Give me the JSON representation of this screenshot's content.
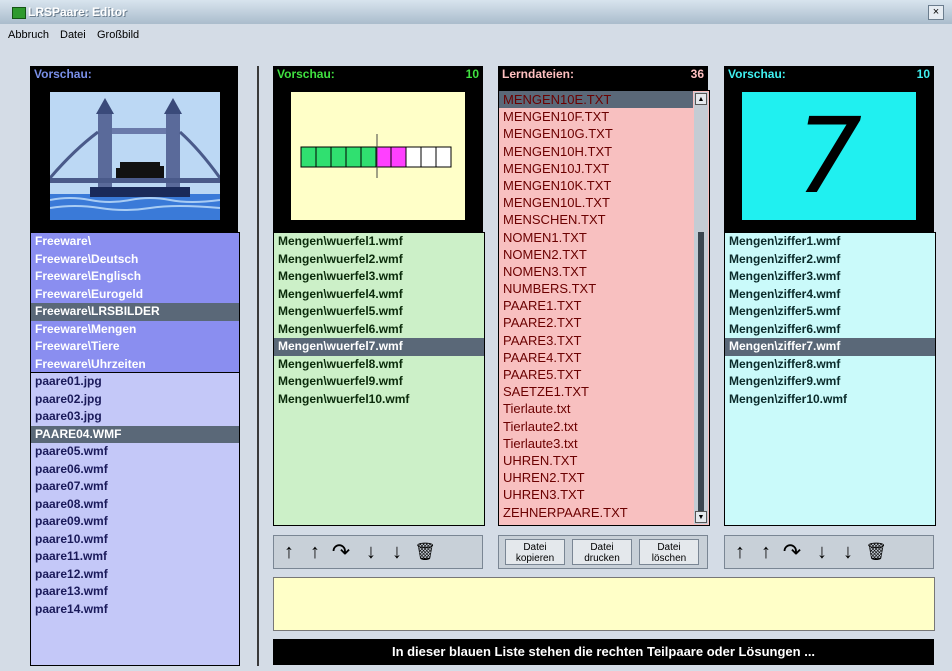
{
  "window": {
    "title": "LRSPaare: Editor",
    "close_glyph": "×"
  },
  "menu": [
    "Abbruch",
    "Datei",
    "Großbild"
  ],
  "left_panel": {
    "header": "Vorschau:",
    "preview_icon": "tower-bridge-image",
    "folders": [
      "Freeware\\",
      "Freeware\\Deutsch",
      "Freeware\\Englisch",
      "Freeware\\Eurogeld",
      "Freeware\\LRSBILDER",
      "Freeware\\Mengen",
      "Freeware\\Tiere",
      "Freeware\\Uhrzeiten"
    ],
    "selected_folder": 4,
    "files": [
      "paare01.jpg",
      "paare02.jpg",
      "paare03.jpg",
      "PAARE04.WMF",
      "paare05.wmf",
      "paare06.wmf",
      "paare07.wmf",
      "paare08.wmf",
      "paare09.wmf",
      "paare10.wmf",
      "paare11.wmf",
      "paare12.wmf",
      "paare13.wmf",
      "paare14.wmf"
    ],
    "selected_file": 3
  },
  "mid_left": {
    "header": "Vorschau:",
    "count": "10",
    "preview_icon": "dice-bar-image",
    "items": [
      "Mengen\\wuerfel1.wmf",
      "Mengen\\wuerfel2.wmf",
      "Mengen\\wuerfel3.wmf",
      "Mengen\\wuerfel4.wmf",
      "Mengen\\wuerfel5.wmf",
      "Mengen\\wuerfel6.wmf",
      "Mengen\\wuerfel7.wmf",
      "Mengen\\wuerfel8.wmf",
      "Mengen\\wuerfel9.wmf",
      "Mengen\\wuerfel10.wmf"
    ],
    "selected": 6
  },
  "lern": {
    "header": "Lerndateien:",
    "count": "36",
    "items": [
      "MENGEN10E.TXT",
      "MENGEN10F.TXT",
      "MENGEN10G.TXT",
      "MENGEN10H.TXT",
      "MENGEN10J.TXT",
      "MENGEN10K.TXT",
      "MENGEN10L.TXT",
      "MENSCHEN.TXT",
      "NOMEN1.TXT",
      "NOMEN2.TXT",
      "NOMEN3.TXT",
      "NUMBERS.TXT",
      "PAARE1.TXT",
      "PAARE2.TXT",
      "PAARE3.TXT",
      "PAARE4.TXT",
      "PAARE5.TXT",
      "SAETZE1.TXT",
      "Tierlaute.txt",
      "Tierlaute2.txt",
      "Tierlaute3.txt",
      "UHREN.TXT",
      "UHREN2.TXT",
      "UHREN3.TXT",
      "ZEHNERPAARE.TXT"
    ],
    "selected": 0,
    "buttons": [
      {
        "line1": "Datei",
        "line2": "kopieren"
      },
      {
        "line1": "Datei",
        "line2": "drucken"
      },
      {
        "line1": "Datei",
        "line2": "löschen"
      }
    ]
  },
  "right_panel": {
    "header": "Vorschau:",
    "count": "10",
    "preview_digit": "7",
    "items": [
      "Mengen\\ziffer1.wmf",
      "Mengen\\ziffer2.wmf",
      "Mengen\\ziffer3.wmf",
      "Mengen\\ziffer4.wmf",
      "Mengen\\ziffer5.wmf",
      "Mengen\\ziffer6.wmf",
      "Mengen\\ziffer7.wmf",
      "Mengen\\ziffer8.wmf",
      "Mengen\\ziffer9.wmf",
      "Mengen\\ziffer10.wmf"
    ],
    "selected": 6
  },
  "toolbar_icons": {
    "up1": "↑",
    "up2": "↑",
    "redo": "↷",
    "down1": "↓",
    "down2": "↓",
    "trash": "🗑"
  },
  "status": "In dieser blauen Liste stehen die rechten Teilpaare oder Lösungen ...",
  "colors": {
    "blue_list": "#c4c8f8",
    "green_list": "#ccf0c8",
    "pink_list": "#f8c0c0",
    "cyan_list": "#cafafa",
    "yellow_area": "#ffffc8"
  }
}
